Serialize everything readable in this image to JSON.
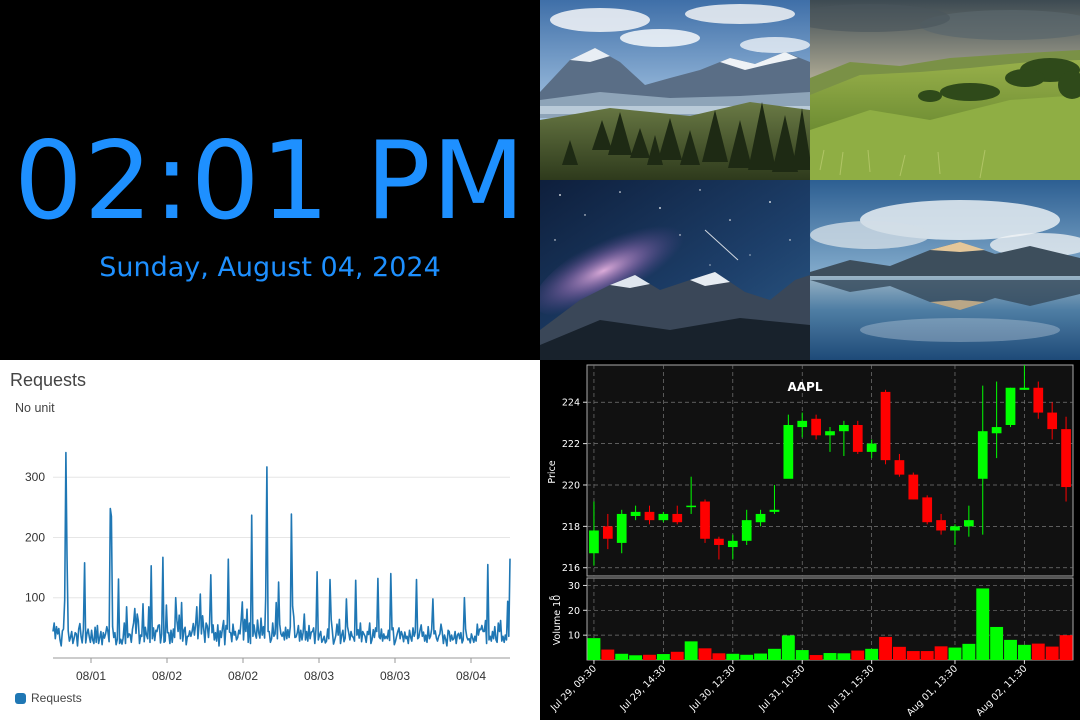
{
  "clock": {
    "time": "02:01 PM",
    "date": "Sunday, August 04, 2024",
    "color": "#1e90ff"
  },
  "photos": [
    {
      "name": "mountain-valley-photo"
    },
    {
      "name": "green-hills-photo"
    },
    {
      "name": "milky-way-mountains-photo"
    },
    {
      "name": "mountain-lake-reflection-photo"
    }
  ],
  "requests": {
    "title": "Requests",
    "unit": "No unit",
    "legend": "Requests",
    "color": "#1f77b4",
    "chart_data": {
      "type": "line",
      "title": "Requests",
      "ylim": [
        0,
        370
      ],
      "yticks": [
        100,
        200,
        300
      ],
      "x_tick_labels": [
        "08/01",
        "08/02",
        "08/02",
        "08/03",
        "08/03",
        "08/04"
      ],
      "series": [
        {
          "name": "Requests",
          "values": [
            44,
            58,
            32,
            52,
            40,
            49,
            30,
            20,
            45,
            48,
            96,
            341,
            170,
            45,
            28,
            34,
            44,
            24,
            32,
            42,
            40,
            20,
            48,
            57,
            35,
            25,
            48,
            158,
            25,
            40,
            48,
            36,
            26,
            46,
            30,
            24,
            51,
            26,
            54,
            24,
            34,
            44,
            22,
            42,
            33,
            40,
            52,
            44,
            27,
            248,
            235,
            52,
            34,
            42,
            22,
            31,
            131,
            24,
            31,
            23,
            33,
            58,
            24,
            85,
            34,
            40,
            39,
            26,
            48,
            58,
            82,
            41,
            73,
            62,
            24,
            38,
            36,
            90,
            27,
            51,
            38,
            32,
            85,
            26,
            153,
            32,
            50,
            29,
            46,
            44,
            54,
            55,
            25,
            40,
            167,
            26,
            28,
            88,
            42,
            42,
            24,
            46,
            26,
            48,
            34,
            100,
            62,
            44,
            71,
            32,
            92,
            28,
            46,
            51,
            22,
            36,
            36,
            45,
            36,
            44,
            57,
            38,
            55,
            85,
            32,
            56,
            106,
            40,
            70,
            47,
            26,
            58,
            53,
            34,
            58,
            138,
            42,
            55,
            30,
            42,
            28,
            55,
            20,
            45,
            34,
            50,
            62,
            22,
            54,
            48,
            164,
            43,
            42,
            27,
            56,
            38,
            44,
            30,
            34,
            46,
            40,
            64,
            93,
            30,
            64,
            44,
            81,
            26,
            58,
            24,
            237,
            36,
            55,
            40,
            33,
            63,
            42,
            33,
            66,
            38,
            52,
            33,
            100,
            317,
            44,
            44,
            26,
            32,
            58,
            36,
            40,
            92,
            32,
            126,
            56,
            40,
            36,
            43,
            30,
            51,
            32,
            47,
            34,
            52,
            239,
            86,
            68,
            34,
            35,
            42,
            54,
            28,
            46,
            30,
            42,
            73,
            30,
            44,
            28,
            54,
            32,
            43,
            44,
            50,
            24,
            48,
            143,
            30,
            38,
            44,
            26,
            30,
            36,
            25,
            28,
            48,
            32,
            130,
            64,
            46,
            23,
            30,
            37,
            56,
            38,
            64,
            24,
            38,
            46,
            27,
            33,
            98,
            52,
            42,
            30,
            44,
            36,
            34,
            28,
            129,
            38,
            47,
            33,
            58,
            27,
            44,
            40,
            36,
            26,
            44,
            39,
            58,
            24,
            31,
            47,
            34,
            50,
            44,
            132,
            35,
            32,
            48,
            28,
            40,
            32,
            36,
            32,
            46,
            29,
            140,
            47,
            50,
            22,
            28,
            36,
            44,
            50,
            32,
            44,
            38,
            27,
            43,
            32,
            36,
            24,
            46,
            34,
            28,
            50,
            36,
            43,
            130,
            32,
            34,
            46,
            55,
            36,
            43,
            28,
            38,
            26,
            52,
            32,
            36,
            48,
            98,
            40,
            45,
            33,
            28,
            36,
            40,
            56,
            44,
            24,
            38,
            31,
            20,
            46,
            44,
            28,
            38,
            30,
            32,
            44,
            24,
            38,
            41,
            32,
            42,
            25,
            30,
            100,
            48,
            35,
            30,
            32,
            25,
            40,
            33,
            26,
            36,
            28,
            56,
            38,
            48,
            47,
            54,
            44,
            44,
            62,
            24,
            155,
            30,
            36,
            28,
            44,
            32,
            52,
            30,
            26,
            58,
            44,
            62,
            28,
            36,
            26,
            38,
            30,
            94,
            36,
            165
          ]
        }
      ]
    }
  },
  "stock": {
    "title": "AAPL",
    "ylabel_price": "Price",
    "ylabel_volume": "Volume  10",
    "ylabel_volume_exp": "6",
    "up_color": "#00ff00",
    "down_color": "#ff0000",
    "chart_data": {
      "type": "candlestick",
      "title": "AAPL",
      "price_ylim": [
        215.6,
        225.8
      ],
      "price_yticks": [
        216,
        218,
        220,
        222,
        224
      ],
      "volume_ylim": [
        0,
        33
      ],
      "volume_yticks": [
        10,
        20,
        30
      ],
      "x_tick_labels": [
        {
          "label": "Jul 29, 09:30",
          "index": 0
        },
        {
          "label": "Jul 29, 14:30",
          "index": 5
        },
        {
          "label": "Jul 30, 12:30",
          "index": 10
        },
        {
          "label": "Jul 31, 10:30",
          "index": 15
        },
        {
          "label": "Jul 31, 15:30",
          "index": 20
        },
        {
          "label": "Aug 01, 13:30",
          "index": 26
        },
        {
          "label": "Aug 02, 11:30",
          "index": 31
        }
      ],
      "candles": [
        {
          "o": 216.7,
          "h": 219.2,
          "l": 216.1,
          "c": 217.8,
          "v": 8.8
        },
        {
          "o": 218.0,
          "h": 218.6,
          "l": 216.9,
          "c": 217.4,
          "v": 4.2
        },
        {
          "o": 217.2,
          "h": 218.8,
          "l": 216.7,
          "c": 218.6,
          "v": 2.5
        },
        {
          "o": 218.5,
          "h": 219.0,
          "l": 218.3,
          "c": 218.7,
          "v": 1.9
        },
        {
          "o": 218.7,
          "h": 219.0,
          "l": 218.1,
          "c": 218.3,
          "v": 2.1
        },
        {
          "o": 218.3,
          "h": 218.7,
          "l": 218.2,
          "c": 218.6,
          "v": 2.4
        },
        {
          "o": 218.6,
          "h": 219.0,
          "l": 218.1,
          "c": 218.2,
          "v": 3.3
        },
        {
          "o": 219.0,
          "h": 220.4,
          "l": 218.6,
          "c": 219.0,
          "v": 7.5
        },
        {
          "o": 219.2,
          "h": 219.3,
          "l": 217.2,
          "c": 217.4,
          "v": 4.7
        },
        {
          "o": 217.4,
          "h": 217.5,
          "l": 216.4,
          "c": 217.1,
          "v": 2.7
        },
        {
          "o": 217.0,
          "h": 217.6,
          "l": 216.4,
          "c": 217.3,
          "v": 2.5
        },
        {
          "o": 217.3,
          "h": 218.8,
          "l": 217.1,
          "c": 218.3,
          "v": 2.1
        },
        {
          "o": 218.2,
          "h": 218.8,
          "l": 218.0,
          "c": 218.6,
          "v": 2.6
        },
        {
          "o": 218.7,
          "h": 220.0,
          "l": 218.6,
          "c": 218.8,
          "v": 4.5
        },
        {
          "o": 220.3,
          "h": 223.4,
          "l": 220.6,
          "c": 222.9,
          "v": 9.9
        },
        {
          "o": 222.8,
          "h": 223.5,
          "l": 222.3,
          "c": 223.1,
          "v": 4.0
        },
        {
          "o": 223.2,
          "h": 223.4,
          "l": 222.2,
          "c": 222.4,
          "v": 2.0
        },
        {
          "o": 222.4,
          "h": 222.8,
          "l": 221.6,
          "c": 222.6,
          "v": 2.8
        },
        {
          "o": 222.6,
          "h": 223.1,
          "l": 221.4,
          "c": 222.9,
          "v": 2.7
        },
        {
          "o": 222.9,
          "h": 223.1,
          "l": 221.5,
          "c": 221.6,
          "v": 3.8
        },
        {
          "o": 221.6,
          "h": 222.2,
          "l": 221.3,
          "c": 222.0,
          "v": 4.5
        },
        {
          "o": 224.5,
          "h": 224.6,
          "l": 221.0,
          "c": 221.2,
          "v": 9.3
        },
        {
          "o": 221.2,
          "h": 221.5,
          "l": 220.4,
          "c": 220.5,
          "v": 5.3
        },
        {
          "o": 220.5,
          "h": 220.6,
          "l": 219.3,
          "c": 219.3,
          "v": 3.6
        },
        {
          "o": 219.4,
          "h": 219.5,
          "l": 218.1,
          "c": 218.2,
          "v": 3.6
        },
        {
          "o": 218.3,
          "h": 218.6,
          "l": 217.6,
          "c": 217.8,
          "v": 5.5
        },
        {
          "o": 217.8,
          "h": 218.1,
          "l": 217.1,
          "c": 218.0,
          "v": 5.0
        },
        {
          "o": 218.0,
          "h": 219.0,
          "l": 217.5,
          "c": 218.3,
          "v": 6.5
        },
        {
          "o": 220.3,
          "h": 224.8,
          "l": 217.6,
          "c": 222.6,
          "v": 28.8
        },
        {
          "o": 222.5,
          "h": 225.0,
          "l": 221.3,
          "c": 222.8,
          "v": 13.3
        },
        {
          "o": 222.9,
          "h": 224.7,
          "l": 222.8,
          "c": 224.7,
          "v": 8.1
        },
        {
          "o": 224.6,
          "h": 225.8,
          "l": 224.6,
          "c": 224.7,
          "v": 6.1
        },
        {
          "o": 224.7,
          "h": 225.0,
          "l": 223.2,
          "c": 223.5,
          "v": 6.6
        },
        {
          "o": 223.5,
          "h": 224.0,
          "l": 222.2,
          "c": 222.7,
          "v": 5.4
        },
        {
          "o": 222.7,
          "h": 223.3,
          "l": 219.2,
          "c": 219.9,
          "v": 10.0
        }
      ]
    }
  }
}
